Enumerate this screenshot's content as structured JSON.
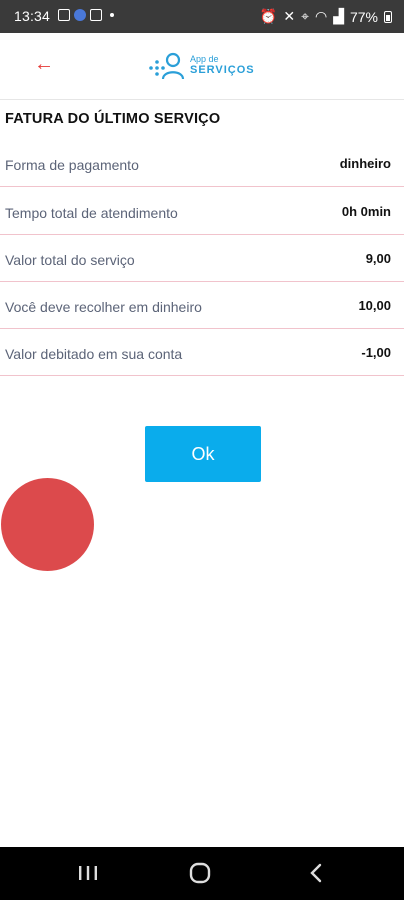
{
  "status_bar": {
    "time": "13:34",
    "battery": "77%"
  },
  "header": {
    "back_icon": "arrow-left-icon",
    "logo": {
      "line1": "App de",
      "line2": "SERVIÇOS",
      "color": "#2a9fd8"
    }
  },
  "invoice": {
    "title": "FATURA DO ÚLTIMO SERVIÇO",
    "rows": [
      {
        "label": "Forma de pagamento",
        "value": "dinheiro"
      },
      {
        "label": "Tempo total de atendimento",
        "value": "0h 0min"
      },
      {
        "label": "Valor total do serviço",
        "value": "9,00"
      },
      {
        "label": "Você deve recolher em dinheiro",
        "value": "10,00"
      },
      {
        "label": "Valor debitado em sua conta",
        "value": "-1,00"
      }
    ]
  },
  "ok_button": {
    "label": "Ok",
    "color": "#0aacec"
  },
  "floating_bubble": {
    "color": "#dc4a4c"
  },
  "nav_bar": {
    "recent_icon": "recent-apps-icon",
    "home_icon": "home-icon",
    "back_icon": "back-icon"
  }
}
